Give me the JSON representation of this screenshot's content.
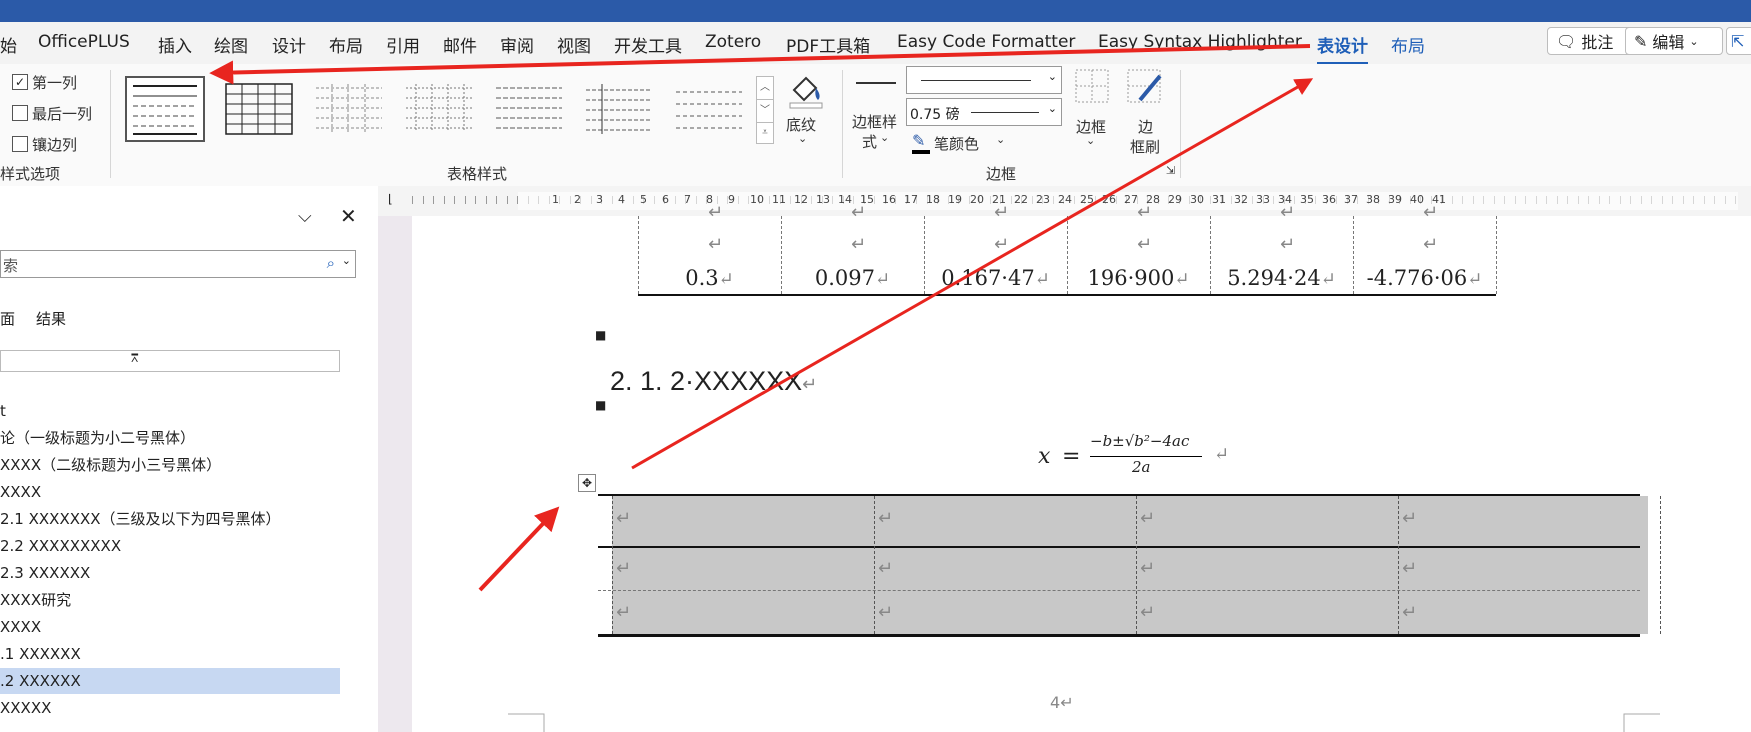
{
  "tabs": [
    "始",
    "OfficePLUS",
    "插入",
    "绘图",
    "设计",
    "布局",
    "引用",
    "邮件",
    "审阅",
    "视图",
    "开发工具",
    "Zotero",
    "PDF工具箱",
    "Easy Code Formatter",
    "Easy Syntax Highlighter",
    "表设计",
    "布局"
  ],
  "header_buttons": {
    "comment": "批注",
    "edit": "编辑"
  },
  "style_options": {
    "items": [
      {
        "label": "第一列",
        "checked": true
      },
      {
        "label": "最后一列",
        "checked": false
      },
      {
        "label": "镶边列",
        "checked": false
      }
    ],
    "group_label": "样式选项"
  },
  "table_styles": {
    "group_label": "表格样式",
    "shading_label": "底纹"
  },
  "borders": {
    "border_style_label_1": "边框样",
    "border_style_label_2": "式",
    "weight": "0.75 磅",
    "pen_color": "笔颜色",
    "borders_button": "边框",
    "painter_1": "边",
    "painter_2": "框刷",
    "group_label": "边框"
  },
  "nav": {
    "search_placeholder": "索",
    "tab_headings": "面",
    "tab_results": "结果",
    "items": [
      "t",
      "论（一级标题为小二号黑体）",
      "XXXX（二级标题为小三号黑体）",
      "XXXX",
      "2.1 XXXXXXX（三级及以下为四号黑体）",
      "2.2 XXXXXXXXX",
      "2.3 XXXXXX",
      "XXXX研究",
      "XXXX",
      ".1 XXXXXX",
      ".2 XXXXXX",
      "XXXXX"
    ],
    "highlighted_index": 10
  },
  "ruler": {
    "numbers": [
      "1",
      "2",
      "3",
      "4",
      "5",
      "6",
      "7",
      "8",
      "9",
      "10",
      "11",
      "12",
      "13",
      "14",
      "15",
      "16",
      "17",
      "18",
      "19",
      "20",
      "21",
      "22",
      "23",
      "24",
      "25",
      "26",
      "27",
      "28",
      "29",
      "30",
      "31",
      "32",
      "33",
      "34",
      "35",
      "36",
      "37",
      "38",
      "39",
      "40",
      "41"
    ]
  },
  "document": {
    "table1_values": [
      "0.3",
      "0.097",
      "0.167·47",
      "196·900",
      "5.294·24",
      "-4.776·06"
    ],
    "heading": "2. 1. 2·XXXXXX",
    "formula_x": "x",
    "formula_eq": "=",
    "formula_num": "−b±√b²−4ac",
    "formula_den": "2a",
    "return_mark": "↵",
    "page_number": "4"
  },
  "colors": {
    "accent": "#1f5fb8",
    "title": "#2b5aa8",
    "arrow": "#e8251f",
    "highlight": "#c7d8f2",
    "shade": "#c8c8c8"
  }
}
